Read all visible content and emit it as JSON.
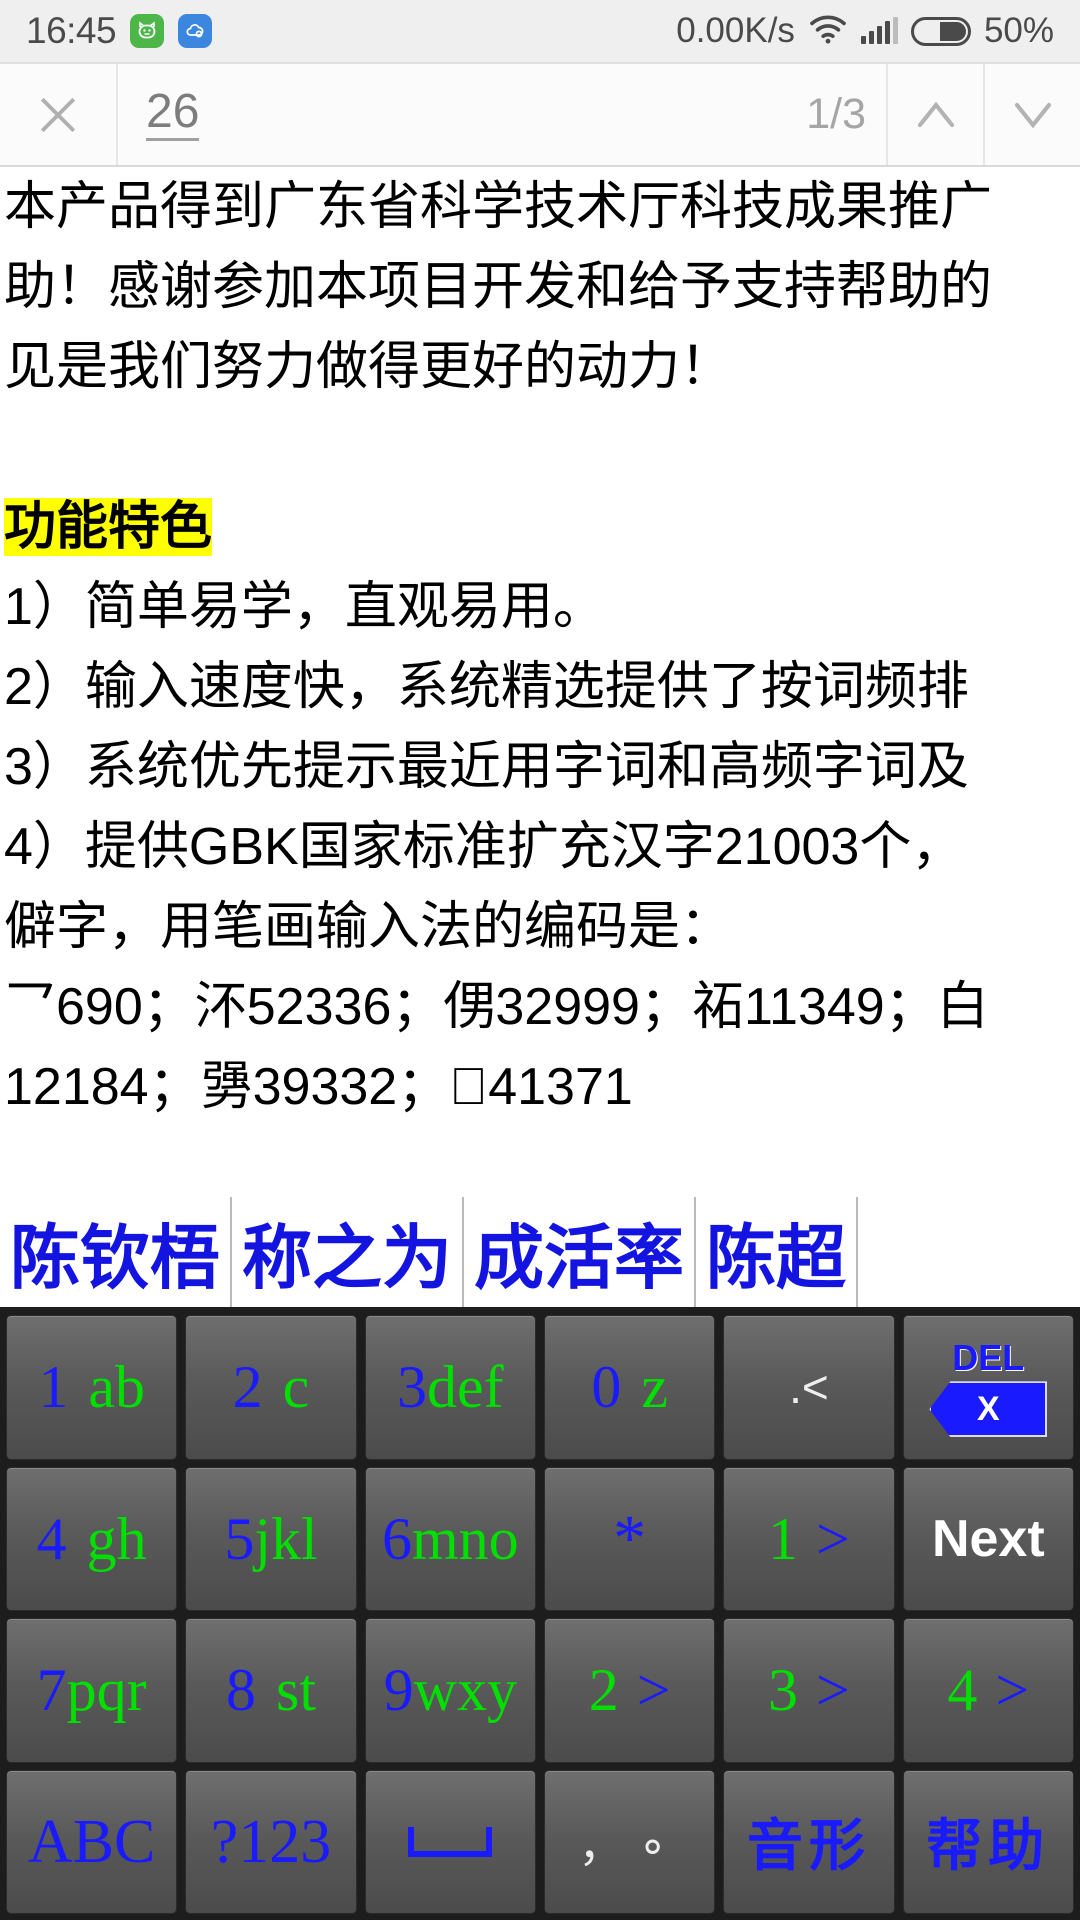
{
  "status_bar": {
    "time": "16:45",
    "app_icon_1": "cat-app-icon",
    "app_icon_2": "cloud-app-icon",
    "network_speed": "0.00K/s",
    "wifi_icon": "wifi-icon",
    "signal_icon": "cellular-signal-icon",
    "battery_icon": "battery-icon",
    "battery_percent": "50%"
  },
  "find_bar": {
    "close_icon": "close-icon",
    "query": "26",
    "match_count": "1/3",
    "prev_icon": "chevron-up-icon",
    "next_icon": "chevron-down-icon"
  },
  "document": {
    "lines": [
      {
        "text": "本产品得到广东省科学技术厅科技成果推广",
        "style": "normal"
      },
      {
        "text": "助！感谢参加本项目开发和给予支持帮助的",
        "style": "normal"
      },
      {
        "text": "见是我们努力做得更好的动力！",
        "style": "normal"
      },
      {
        "text": "",
        "style": "gap"
      },
      {
        "text": "功能特色",
        "style": "highlight"
      },
      {
        "text": "1）简单易学，直观易用。",
        "style": "normal"
      },
      {
        "text": "2）输入速度快，系统精选提供了按词频排",
        "style": "normal"
      },
      {
        "text": "3）系统优先提示最近用字词和高频字词及",
        "style": "normal"
      },
      {
        "text": "4）提供GBK国家标准扩充汉字21003个，",
        "style": "normal"
      },
      {
        "text": "僻字，用笔画输入法的编码是：",
        "style": "normal"
      },
      {
        "text": "乛690；㳅52336；侽32999；祏11349；白",
        "style": "normal"
      },
      {
        "text": "12184；勥39332；􏿽41371",
        "style": "normal"
      }
    ]
  },
  "candidates": {
    "items": [
      "陈钦梧",
      "称之为",
      "成活率",
      "陈超"
    ]
  },
  "keyboard": {
    "rows": [
      [
        {
          "name": "key-1-ab",
          "num": "1",
          "alpha": "ab",
          "type": "numalpha"
        },
        {
          "name": "key-2-c",
          "num": "2",
          "alpha": "c",
          "type": "numalpha"
        },
        {
          "name": "key-3-def",
          "num": "3",
          "alpha": "def",
          "type": "numalpha-tight"
        },
        {
          "name": "key-0-z",
          "num": "0",
          "alpha": "z",
          "type": "numalpha"
        },
        {
          "name": "key-punct-dot-lt",
          "label": ".<",
          "type": "punct"
        },
        {
          "name": "key-delete",
          "label": "DEL",
          "badge": "X",
          "type": "delete"
        }
      ],
      [
        {
          "name": "key-4-gh",
          "num": "4",
          "alpha": "gh",
          "type": "numalpha"
        },
        {
          "name": "key-5-jkl",
          "num": "5",
          "alpha": "jkl",
          "type": "numalpha-tight"
        },
        {
          "name": "key-6-mno",
          "num": "6",
          "alpha": "mno",
          "type": "numalpha-tight"
        },
        {
          "name": "key-asterisk",
          "label": "*",
          "type": "bluesym"
        },
        {
          "name": "key-1-gt",
          "num2": "1",
          "sym": ">",
          "type": "greenblue"
        },
        {
          "name": "key-next",
          "label": "Next",
          "type": "white"
        }
      ],
      [
        {
          "name": "key-7-pqr",
          "num": "7",
          "alpha": "pqr",
          "type": "numalpha-tight"
        },
        {
          "name": "key-8-st",
          "num": "8",
          "alpha": "st",
          "type": "numalpha"
        },
        {
          "name": "key-9-wxy",
          "num": "9",
          "alpha": "wxy",
          "type": "numalpha-tight"
        },
        {
          "name": "key-2-gt",
          "num2": "2",
          "sym": ">",
          "type": "greenblue"
        },
        {
          "name": "key-3-gt",
          "num2": "3",
          "sym": ">",
          "type": "greenblue"
        },
        {
          "name": "key-4-gt",
          "num2": "4",
          "sym": ">",
          "type": "greenblue"
        }
      ],
      [
        {
          "name": "key-abc",
          "label": "ABC",
          "type": "bluetext"
        },
        {
          "name": "key-123",
          "label": "?123",
          "type": "bluetext"
        },
        {
          "name": "key-space",
          "label": "",
          "type": "space"
        },
        {
          "name": "key-punct-comma-circle",
          "label": "，∘",
          "type": "punct2"
        },
        {
          "name": "key-yinxing",
          "label": "音形",
          "type": "cn"
        },
        {
          "name": "key-help",
          "label": "帮助",
          "type": "cn"
        }
      ]
    ]
  },
  "colors": {
    "key_number": "#1a1aff",
    "key_alpha": "#00e000",
    "candidate_text": "#1414e0",
    "highlight": "#ffff00",
    "keyboard_bg": "#1d1d1d"
  }
}
